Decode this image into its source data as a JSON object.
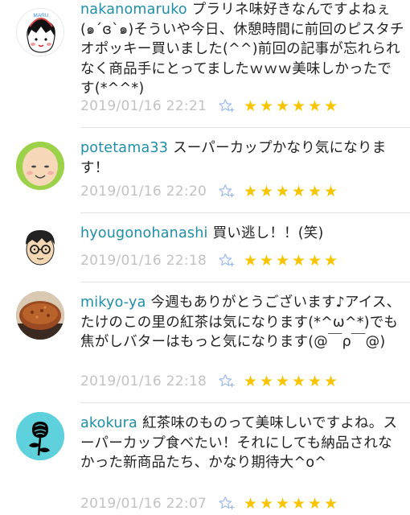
{
  "comments": [
    {
      "username": "nakanomaruko",
      "text": "プラリネ味好きなんですよねぇ(๑´ɞ`๑)そういや今日、休憩時間に前回のピスタチオポッキー買いました(^^)前回の記事が忘れられなく商品手にとってましたｗｗｗ美味しかったです(*^^*)",
      "date": "2019/01/16 22:21",
      "rating": 6,
      "avatar_label": "MARU"
    },
    {
      "username": "potetama33",
      "text": "スーパーカップかなり気になります！",
      "date": "2019/01/16 22:20",
      "rating": 6
    },
    {
      "username": "hyougonohanashi",
      "text": "買い逃し！！(笑)",
      "date": "2019/01/16 22:18",
      "rating": 6
    },
    {
      "username": "mikyo-ya",
      "text": "今週もありがとうございます♪アイス、たけのこの里の紅茶は気になります(*^ω^*)でも焦がしバターはもっと気になります(@￣ρ￣@)",
      "date": "2019/01/16 22:18",
      "rating": 6
    },
    {
      "username": "akokura",
      "text": "紅茶味のものって美味しいですよね。スーパーカップ食べたい！それにしても納品されなかった新商品たち、かなり期待大^o^",
      "date": "2019/01/16 22:07",
      "rating": 6
    }
  ],
  "colors": {
    "username": "#1f8ea8",
    "date": "#c2c2c2",
    "star": "#f7c400"
  },
  "icons": {
    "favorite": "star-outline-plus-icon",
    "rating": "star-icon"
  }
}
